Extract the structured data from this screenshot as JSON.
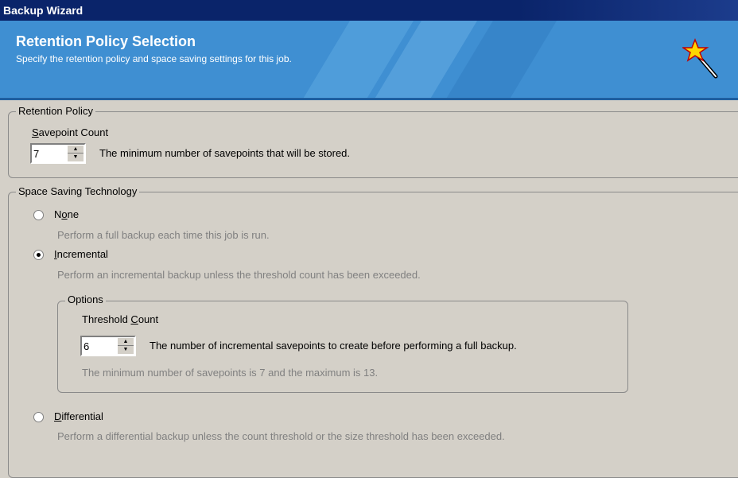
{
  "window": {
    "title": "Backup Wizard"
  },
  "banner": {
    "title": "Retention Policy Selection",
    "subtitle": "Specify the retention policy and space saving settings for this job."
  },
  "retention": {
    "legend": "Retention Policy",
    "savepoint_label_first": "S",
    "savepoint_label_rest": "avepoint Count",
    "savepoint_value": "7",
    "savepoint_desc": "The minimum number of savepoints that will be stored."
  },
  "space": {
    "legend": "Space Saving Technology",
    "none": {
      "label_pre": "N",
      "label_acc": "o",
      "label_post": "ne",
      "desc": "Perform a full backup each time this job is run.",
      "checked": false
    },
    "incremental": {
      "label_acc": "I",
      "label_post": "ncremental",
      "desc": "Perform an incremental backup unless the threshold count has been exceeded.",
      "checked": true
    },
    "options": {
      "legend": "Options",
      "threshold_label_pre": "Threshold ",
      "threshold_label_acc": "C",
      "threshold_label_post": "ount",
      "threshold_value": "6",
      "threshold_desc": "The number of incremental savepoints to create before performing a full backup.",
      "range_note": "The minimum number of savepoints is 7 and the maximum is 13."
    },
    "differential": {
      "label_acc": "D",
      "label_post": "ifferential",
      "desc": "Perform a differential backup unless the count threshold or the size threshold has been exceeded.",
      "checked": false
    }
  }
}
